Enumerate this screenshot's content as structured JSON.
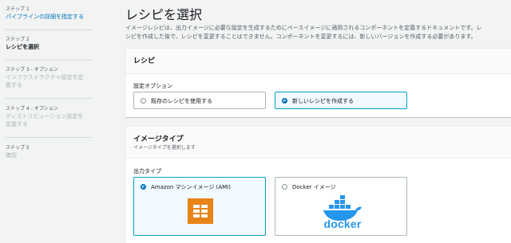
{
  "sidebar": {
    "steps": [
      {
        "num": "ステップ 1",
        "title": "パイプラインの詳細を指定する",
        "state": "link"
      },
      {
        "num": "ステップ 2",
        "title": "レシピを選択",
        "state": "active"
      },
      {
        "num": "ステップ 3 - オプション",
        "title_line1": "インフラストラクチャ設定を定",
        "title_line2": "義する",
        "state": "disabled"
      },
      {
        "num": "ステップ 4 - オプション",
        "title_line1": "ディストリビューション設定を",
        "title_line2": "定義する",
        "state": "disabled"
      },
      {
        "num": "ステップ 5",
        "title": "確認",
        "state": "disabled"
      }
    ]
  },
  "main": {
    "title": "レシピを選択",
    "description_line1": "イメージレシピは、出力イメージに必要な設定を生成するためにベースイメージに適用されるコンポーネントを定義するドキュメントです。レ",
    "description_line2": "シピを作成した後で、レシピを変更することはできません。コンポーネントを変更するには、新しいバージョンを作成する必要があります。"
  },
  "recipe_card": {
    "title": "レシピ",
    "field_label": "設定オプション",
    "options": [
      {
        "label": "既存のレシピを使用する",
        "selected": false
      },
      {
        "label": "新しいレシピを作成する",
        "selected": true
      }
    ]
  },
  "image_type_card": {
    "title": "イメージタイプ",
    "subtitle": "イメージタイプを選択します",
    "field_label": "出力タイプ",
    "options": [
      {
        "label": "Amazon マシンイメージ (AMI)",
        "selected": true,
        "icon": "ami-grid-icon"
      },
      {
        "label": "Docker イメージ",
        "selected": false,
        "icon": "docker-logo-icon",
        "logo_text": "docker"
      }
    ]
  },
  "colors": {
    "link": "#0073bb",
    "selected_border": "#00a1c9",
    "ami_orange": "#e78519",
    "docker_blue": "#2496ed"
  }
}
